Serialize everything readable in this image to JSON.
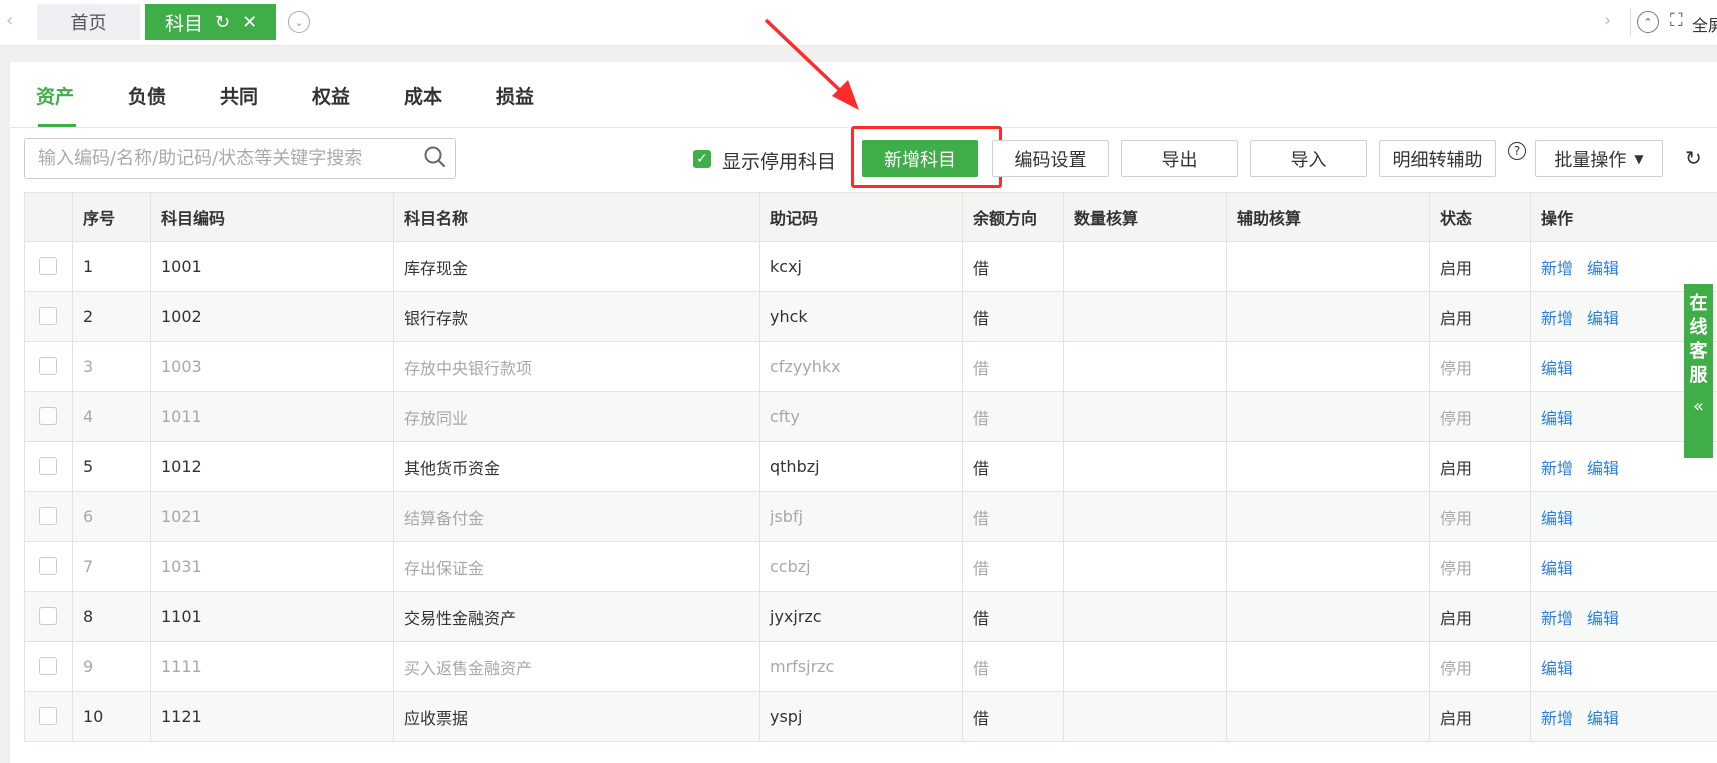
{
  "tabbar": {
    "home": "首页",
    "active": "科目",
    "fullscreen": "全屏"
  },
  "categories": [
    "资产",
    "负债",
    "共同",
    "权益",
    "成本",
    "损益"
  ],
  "toolbar": {
    "search_placeholder": "输入编码/名称/助记码/状态等关键字搜索",
    "show_disabled": "显示停用科目",
    "add": "新增科目",
    "code_settings": "编码设置",
    "export": "导出",
    "import": "导入",
    "detail_to_aux": "明细转辅助",
    "batch": "批量操作"
  },
  "table": {
    "headers": [
      "序号",
      "科目编码",
      "科目名称",
      "助记码",
      "余额方向",
      "数量核算",
      "辅助核算",
      "状态",
      "操作"
    ],
    "rows": [
      [
        "1",
        "1001",
        "库存现金",
        "kcxj",
        "借",
        "",
        "",
        "启用"
      ],
      [
        "2",
        "1002",
        "银行存款",
        "yhck",
        "借",
        "",
        "",
        "启用"
      ],
      [
        "3",
        "1003",
        "存放中央银行款项",
        "cfzyyhkx",
        "借",
        "",
        "",
        "停用"
      ],
      [
        "4",
        "1011",
        "存放同业",
        "cfty",
        "借",
        "",
        "",
        "停用"
      ],
      [
        "5",
        "1012",
        "其他货币资金",
        "qthbzj",
        "借",
        "",
        "",
        "启用"
      ],
      [
        "6",
        "1021",
        "结算备付金",
        "jsbfj",
        "借",
        "",
        "",
        "停用"
      ],
      [
        "7",
        "1031",
        "存出保证金",
        "ccbzj",
        "借",
        "",
        "",
        "停用"
      ],
      [
        "8",
        "1101",
        "交易性金融资产",
        "jyxjrzc",
        "借",
        "",
        "",
        "启用"
      ],
      [
        "9",
        "1111",
        "买入返售金融资产",
        "mrfsjrzc",
        "借",
        "",
        "",
        "停用"
      ],
      [
        "10",
        "1121",
        "应收票据",
        "yspj",
        "借",
        "",
        "",
        "启用"
      ]
    ],
    "op_add": "新增",
    "op_edit": "编辑"
  },
  "side_service": "在线客服",
  "colors": {
    "accent": "#3fae49",
    "link": "#2d7ddf",
    "highlight": "#ff2a2a"
  }
}
